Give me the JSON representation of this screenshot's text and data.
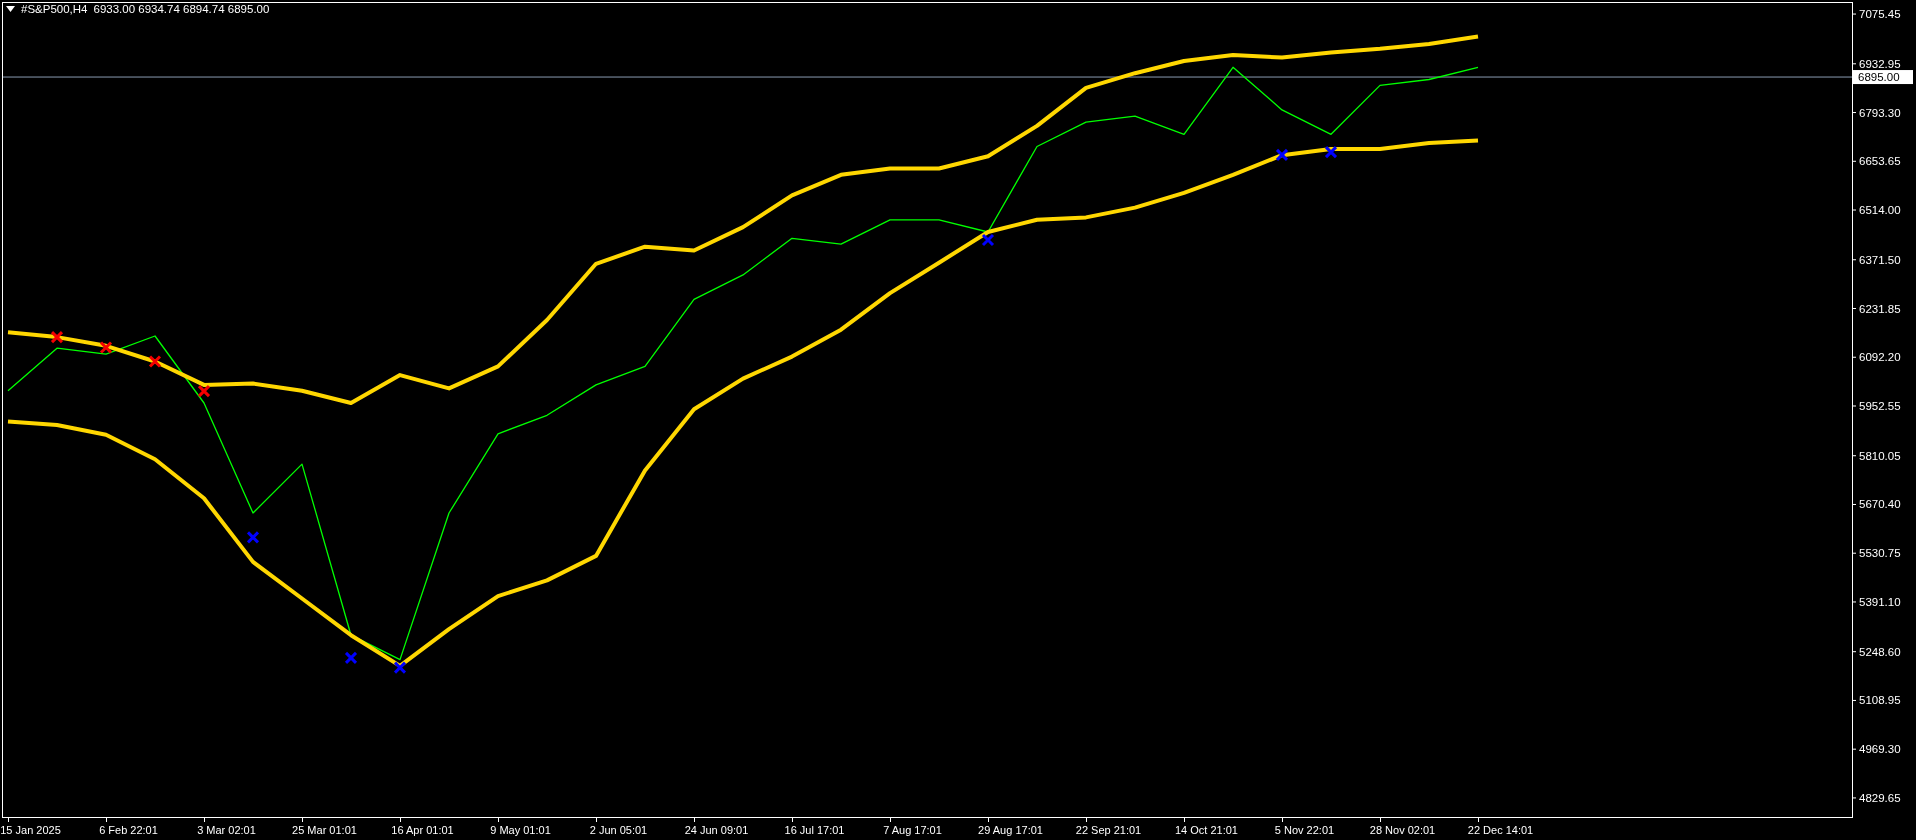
{
  "header": {
    "symbol": "#S&P500,H4",
    "quote": "6933.00 6934.74 6894.74 6895.00"
  },
  "chart": {
    "chart_data": {
      "type": "line",
      "categories": [
        "15 Jan 2025",
        null,
        "6 Feb 22:01",
        null,
        "3 Mar 02:01",
        null,
        "25 Mar 01:01",
        null,
        "16 Apr 01:01",
        null,
        "9 May 01:01",
        null,
        "2 Jun 05:01",
        null,
        "24 Jun 09:01",
        null,
        "16 Jul 17:01",
        null,
        "7 Aug 17:01",
        null,
        "29 Aug 17:01",
        null,
        "22 Sep 21:01",
        null,
        "14 Oct 21:01",
        null,
        "5 Nov 22:01",
        null,
        "28 Nov 02:01",
        null,
        "22 Dec 14:01"
      ],
      "series": [
        {
          "color": "#00ff00",
          "values": [
            5996,
            6118,
            6101,
            6153,
            5961,
            5646,
            5786,
            5296,
            5226,
            5646,
            5873,
            5926,
            6013,
            6066,
            6258,
            6328,
            6433,
            6416,
            6486,
            6486,
            6451,
            6696,
            6766,
            6783,
            6731,
            6923,
            6801,
            6731,
            6871,
            6888,
            6923
          ]
        },
        {
          "color": "#ffd700",
          "values": [
            6164,
            6150,
            6125,
            6080,
            6013,
            6017,
            5996,
            5961,
            6041,
            6003,
            6066,
            6199,
            6360,
            6409,
            6398,
            6465,
            6556,
            6615,
            6633,
            6633,
            6668,
            6755,
            6864,
            6906,
            6941,
            6958,
            6951,
            6965,
            6976,
            6990,
            7011
          ]
        },
        {
          "color": "#ffd700",
          "values": [
            5908,
            5898,
            5870,
            5800,
            5688,
            5506,
            5401,
            5296,
            5208,
            5313,
            5408,
            5453,
            5523,
            5768,
            5943,
            6031,
            6094,
            6171,
            6276,
            6363,
            6451,
            6486,
            6493,
            6521,
            6563,
            6615,
            6671,
            6689,
            6689,
            6706,
            6713
          ]
        },
        {
          "type": "scatter",
          "color": "#f50000",
          "values": [
            null,
            6150,
            6120,
            6080,
            5995,
            null,
            null,
            null,
            null,
            null,
            null,
            null,
            null,
            null,
            null,
            null,
            null,
            null,
            null,
            null,
            null,
            null,
            null,
            null,
            null,
            null,
            null,
            null,
            null,
            null,
            null
          ]
        },
        {
          "type": "scatter",
          "color": "#0000ff",
          "values": [
            null,
            null,
            null,
            null,
            null,
            5576,
            null,
            5231,
            5203,
            null,
            null,
            null,
            null,
            null,
            null,
            null,
            null,
            null,
            null,
            null,
            6428,
            null,
            null,
            null,
            null,
            null,
            6672,
            6680,
            null,
            null,
            null
          ]
        }
      ],
      "ylim": [
        4775,
        7110
      ],
      "yticks": [
        {
          "value": 7075.45,
          "label": "7075.45"
        },
        {
          "value": 6932.95,
          "label": "6932.95"
        },
        {
          "value": 6793.3,
          "label": "6793.30"
        },
        {
          "value": 6653.65,
          "label": "6653.65"
        },
        {
          "value": 6514,
          "label": "6514.00"
        },
        {
          "value": 6371.5,
          "label": "6371.50"
        },
        {
          "value": 6231.85,
          "label": "6231.85"
        },
        {
          "value": 6092.2,
          "label": "6092.20"
        },
        {
          "value": 5952.55,
          "label": "5952.55"
        },
        {
          "value": 5810.05,
          "label": "5810.05"
        },
        {
          "value": 5670.4,
          "label": "5670.40"
        },
        {
          "value": 5530.75,
          "label": "5530.75"
        },
        {
          "value": 5391.1,
          "label": "5391.10"
        },
        {
          "value": 5248.6,
          "label": "5248.60"
        },
        {
          "value": 5108.95,
          "label": "5108.95"
        },
        {
          "value": 4969.3,
          "label": "4969.30"
        },
        {
          "value": 4829.65,
          "label": "4829.65"
        }
      ],
      "ref_lines": [
        {
          "axis": "y",
          "value": 6895,
          "label": "6895.00"
        }
      ]
    }
  }
}
